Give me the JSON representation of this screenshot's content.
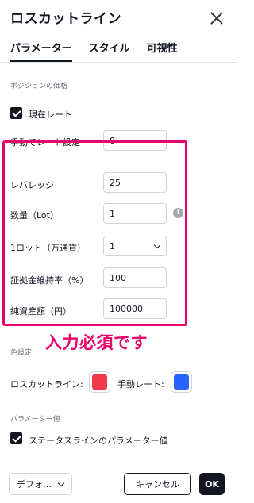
{
  "dialog": {
    "title": "ロスカットライン"
  },
  "tabs": [
    {
      "label": "パラメーター",
      "active": true
    },
    {
      "label": "スタイル",
      "active": false
    },
    {
      "label": "可視性",
      "active": false
    }
  ],
  "position_price": {
    "section_label": "ポジションの価格",
    "current_rate": {
      "label": "現在レート",
      "checked": true
    },
    "manual_rate": {
      "label": "手動でレート設定",
      "value": "0"
    }
  },
  "fields": {
    "leverage": {
      "label": "レバレッジ",
      "value": "25"
    },
    "quantity": {
      "label": "数量（Lot）",
      "value": "1",
      "info_icon": "info-icon"
    },
    "lot_unit": {
      "label": "1ロット（万通貨）",
      "value": "1"
    },
    "margin_rate": {
      "label": "証拠金維持率（%）",
      "value": "100"
    },
    "net_assets": {
      "label": "純資産額（円）",
      "value": "100000"
    }
  },
  "annotation": {
    "text": "入力必須です",
    "color": "#e8006b"
  },
  "color_settings": {
    "section_label": "色設定",
    "losscut_line": {
      "label": "ロスカットライン:",
      "color": "#f03a4a"
    },
    "manual_rate": {
      "label": "手動レート:",
      "color": "#2962ff"
    }
  },
  "parameter_value": {
    "section_label": "パラメーター値",
    "status_line": {
      "label": "ステータスラインのパラメーター値",
      "checked": true
    }
  },
  "footer": {
    "template_label": "デフォ…",
    "cancel_label": "キャンセル",
    "ok_label": "OK"
  }
}
